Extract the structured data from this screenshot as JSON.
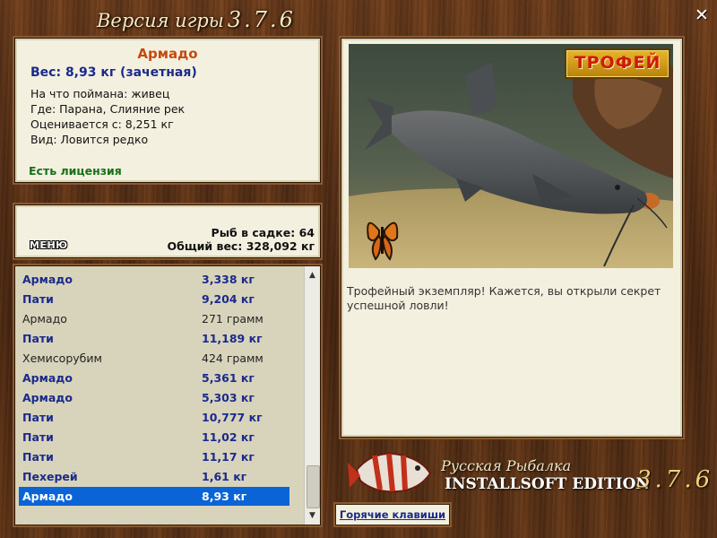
{
  "header": {
    "version_label": "Версия игры",
    "version_number": "3.7.6",
    "close_symbol": "✕"
  },
  "info": {
    "fish_name": "Армадо",
    "weight": "Вес: 8,93 кг (зачетная)",
    "details": [
      "На что поймана: живец",
      "Где: Парана, Слияние рек",
      "Оценивается с: 8,251 кг",
      "Вид: Ловится редко"
    ],
    "license": "Есть лицензия"
  },
  "cage": {
    "menu_label": "МЕНЮ",
    "fish_count": "Рыб в садке: 64",
    "total_weight": "Общий вес: 328,092 кг"
  },
  "catch_list": {
    "rows": [
      {
        "name": "Армадо",
        "weight": "3,338 кг",
        "style": "bold"
      },
      {
        "name": "Пати",
        "weight": "9,204 кг",
        "style": "bold"
      },
      {
        "name": "Армадо",
        "weight": "271 грамм",
        "style": "plain"
      },
      {
        "name": "Пати",
        "weight": "11,189 кг",
        "style": "bold"
      },
      {
        "name": "Хемисорубим",
        "weight": "424 грамм",
        "style": "plain"
      },
      {
        "name": "Армадо",
        "weight": "5,361 кг",
        "style": "bold"
      },
      {
        "name": "Армадо",
        "weight": "5,303 кг",
        "style": "bold"
      },
      {
        "name": "Пати",
        "weight": "10,777 кг",
        "style": "bold"
      },
      {
        "name": "Пати",
        "weight": "11,02 кг",
        "style": "bold"
      },
      {
        "name": "Пати",
        "weight": "11,17 кг",
        "style": "bold"
      },
      {
        "name": "Пехерей",
        "weight": "1,61 кг",
        "style": "bold"
      },
      {
        "name": "Армадо",
        "weight": "8,93 кг",
        "style": "selected"
      }
    ]
  },
  "photo": {
    "trophy_badge": "ТРОФЕЙ",
    "description": "Трофейный экземпляр! Кажется, вы открыли секрет успешной ловли!"
  },
  "logo": {
    "line1": "Русская Рыбалка",
    "line2": "INSTALLSOFT EDITION",
    "version": "3.7.6"
  },
  "hotkeys_label": "Горячие клавиши"
}
